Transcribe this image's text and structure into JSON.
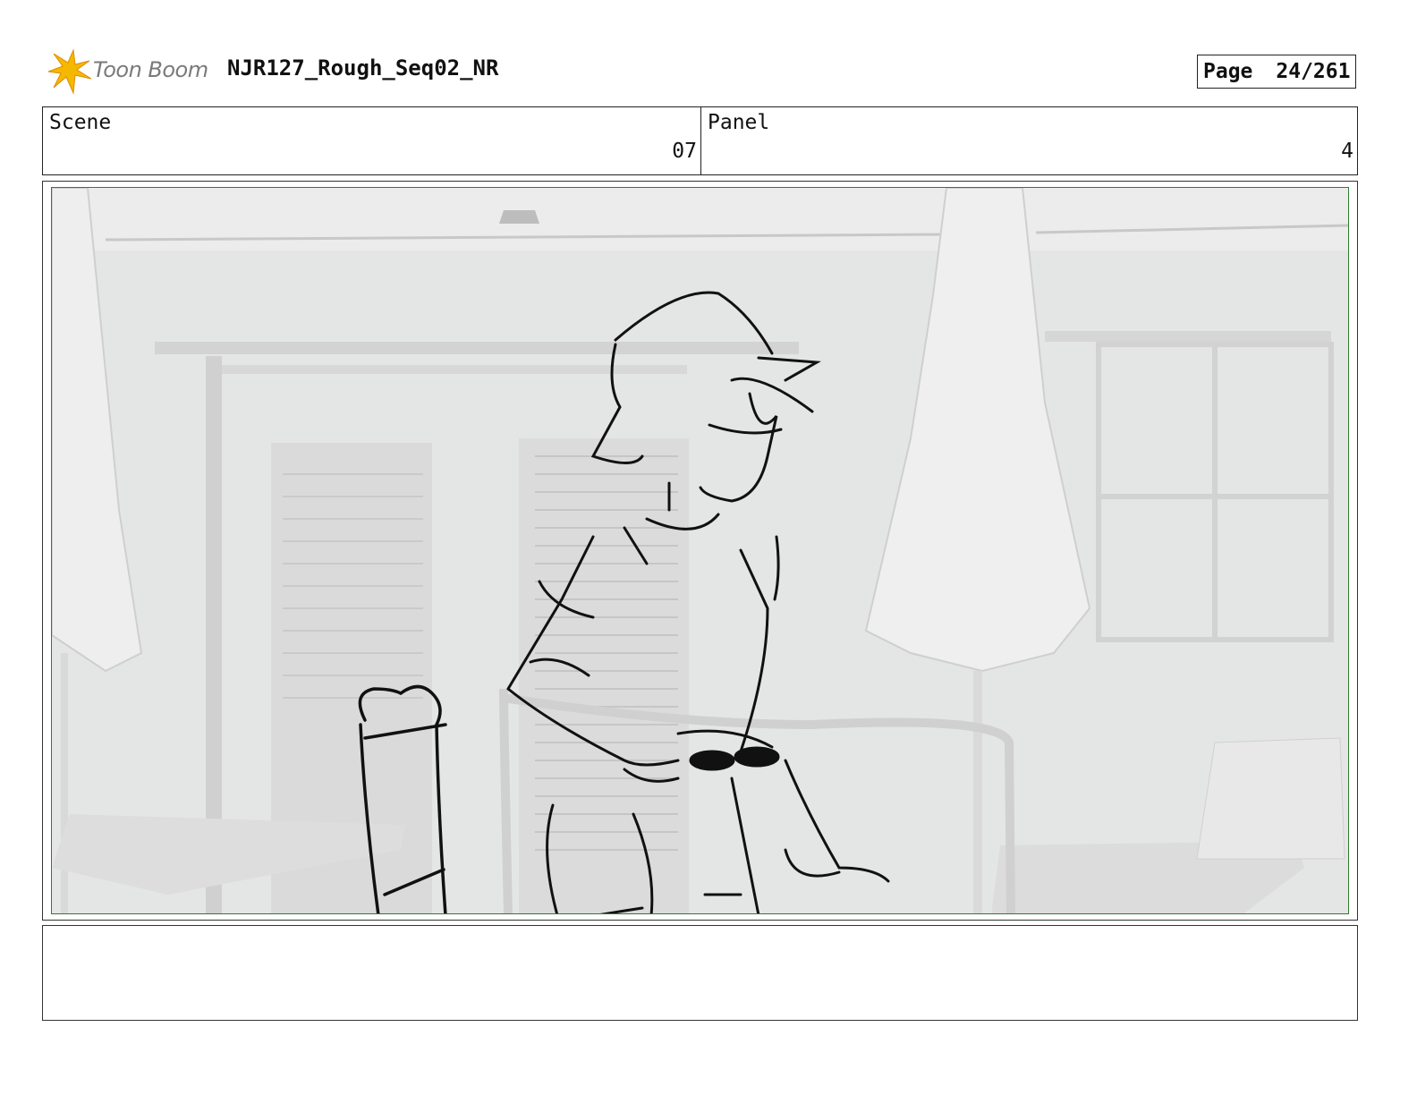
{
  "header": {
    "logo_text": "Toon Boom",
    "project_title": "NJR127_Rough_Seq02_NR",
    "page_label": "Page",
    "page_number": "24/261"
  },
  "info": {
    "scene_label": "Scene",
    "scene_value": "07",
    "panel_label": "Panel",
    "panel_value": "4"
  },
  "panel_image": {
    "content": "rough-sketch-over-3d-background",
    "icon_names": [
      "umbrella-left",
      "umbrella-right",
      "character-sketch",
      "chair-sketch",
      "sunglasses"
    ]
  },
  "notes": {
    "text": ""
  },
  "colors": {
    "frame_border": "#2e7d32",
    "logo_accent": "#f5b800",
    "background_gray": "#e6e7e7"
  }
}
